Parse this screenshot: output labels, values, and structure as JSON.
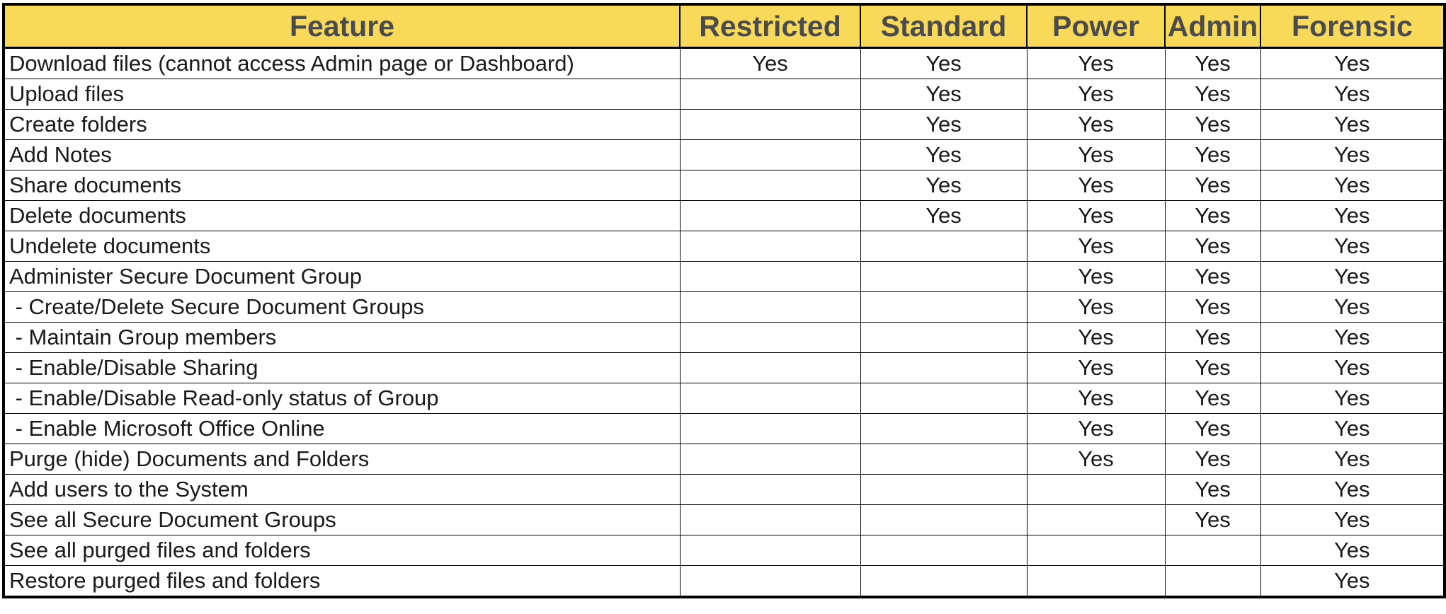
{
  "columns": [
    "Feature",
    "Restricted",
    "Standard",
    "Power",
    "Admin",
    "Forensic"
  ],
  "rows": [
    {
      "feature": "Download files (cannot access Admin page or Dashboard)",
      "restricted": "Yes",
      "standard": "Yes",
      "power": "Yes",
      "admin": "Yes",
      "forensic": "Yes"
    },
    {
      "feature": "Upload files",
      "restricted": "",
      "standard": "Yes",
      "power": "Yes",
      "admin": "Yes",
      "forensic": "Yes"
    },
    {
      "feature": "Create folders",
      "restricted": "",
      "standard": "Yes",
      "power": "Yes",
      "admin": "Yes",
      "forensic": "Yes"
    },
    {
      "feature": "Add Notes",
      "restricted": "",
      "standard": "Yes",
      "power": "Yes",
      "admin": "Yes",
      "forensic": "Yes"
    },
    {
      "feature": "Share documents",
      "restricted": "",
      "standard": "Yes",
      "power": "Yes",
      "admin": "Yes",
      "forensic": "Yes"
    },
    {
      "feature": "Delete documents",
      "restricted": "",
      "standard": "Yes",
      "power": "Yes",
      "admin": "Yes",
      "forensic": "Yes"
    },
    {
      "feature": "Undelete documents",
      "restricted": "",
      "standard": "",
      "power": "Yes",
      "admin": "Yes",
      "forensic": "Yes"
    },
    {
      "feature": "Administer Secure Document Group",
      "restricted": "",
      "standard": "",
      "power": "Yes",
      "admin": "Yes",
      "forensic": "Yes"
    },
    {
      "feature": " - Create/Delete Secure Document Groups",
      "restricted": "",
      "standard": "",
      "power": "Yes",
      "admin": "Yes",
      "forensic": "Yes"
    },
    {
      "feature": " - Maintain Group members",
      "restricted": "",
      "standard": "",
      "power": "Yes",
      "admin": "Yes",
      "forensic": "Yes"
    },
    {
      "feature": " - Enable/Disable Sharing",
      "restricted": "",
      "standard": "",
      "power": "Yes",
      "admin": "Yes",
      "forensic": "Yes"
    },
    {
      "feature": " - Enable/Disable Read-only status of Group",
      "restricted": "",
      "standard": "",
      "power": "Yes",
      "admin": "Yes",
      "forensic": "Yes"
    },
    {
      "feature": " - Enable Microsoft Office Online",
      "restricted": "",
      "standard": "",
      "power": "Yes",
      "admin": "Yes",
      "forensic": "Yes"
    },
    {
      "feature": "Purge (hide) Documents and Folders",
      "restricted": "",
      "standard": "",
      "power": "Yes",
      "admin": "Yes",
      "forensic": "Yes"
    },
    {
      "feature": "Add users to the System",
      "restricted": "",
      "standard": "",
      "power": "",
      "admin": "Yes",
      "forensic": "Yes"
    },
    {
      "feature": "See all Secure Document Groups",
      "restricted": "",
      "standard": "",
      "power": "",
      "admin": "Yes",
      "forensic": "Yes"
    },
    {
      "feature": "See all purged files and folders",
      "restricted": "",
      "standard": "",
      "power": "",
      "admin": "",
      "forensic": "Yes"
    },
    {
      "feature": "Restore purged files and folders",
      "restricted": "",
      "standard": "",
      "power": "",
      "admin": "",
      "forensic": "Yes"
    }
  ],
  "colors": {
    "header_fill": "#f9d95a",
    "header_text": "#4b4b4b",
    "grid_lines": "#000000"
  }
}
